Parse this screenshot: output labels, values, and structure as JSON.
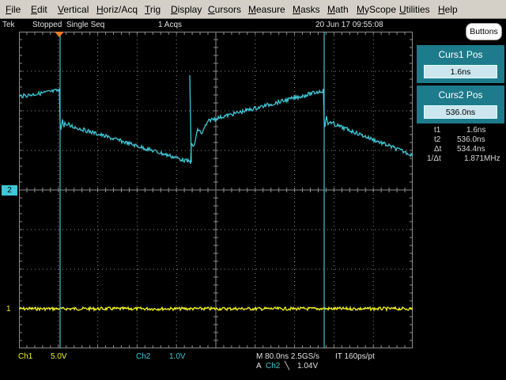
{
  "menu": {
    "items": [
      {
        "u": "F",
        "rest": "ile"
      },
      {
        "u": "E",
        "rest": "dit"
      },
      {
        "u": "V",
        "rest": "ertical"
      },
      {
        "u": "H",
        "rest": "oriz/Acq"
      },
      {
        "u": "T",
        "rest": "rig"
      },
      {
        "u": "D",
        "rest": "isplay"
      },
      {
        "u": "C",
        "rest": "ursors"
      },
      {
        "u": "M",
        "rest": "easure"
      },
      {
        "u": "M",
        "rest": "asks"
      },
      {
        "u": "M",
        "rest": "ath"
      },
      {
        "u": "M",
        "rest": "yScope"
      },
      {
        "u": "U",
        "rest": "tilities"
      },
      {
        "u": "H",
        "rest": "elp"
      }
    ]
  },
  "status": {
    "brand": "Tek",
    "state": "Stopped",
    "mode": "Single Seq",
    "acqs": "1 Acqs",
    "timestamp": "20 Jun 17 09:55:08"
  },
  "buttons_label": "Buttons",
  "cursor1": {
    "title": "Curs1 Pos",
    "value": "1.6ns"
  },
  "cursor2": {
    "title": "Curs2 Pos",
    "value": "536.0ns"
  },
  "readouts": [
    {
      "label": "t1",
      "value": "1.6ns"
    },
    {
      "label": "t2",
      "value": "536.0ns"
    },
    {
      "label": "Δt",
      "value": "534.4ns"
    },
    {
      "label": "1/Δt",
      "value": "1.871MHz"
    }
  ],
  "channels": {
    "ch1": {
      "label": "Ch1",
      "scale": "5.0V",
      "marker": "1",
      "color": "#f2f21e"
    },
    "ch2": {
      "label": "Ch2",
      "scale": "1.0V",
      "marker": "2",
      "color": "#3ec6d6"
    }
  },
  "horizontal": {
    "main": "M 80.0ns 2.5GS/s",
    "interval": "IT 160ps/pt",
    "trigger_prefix": "A",
    "trigger_source": "Ch2",
    "trigger_slope_icon": "falling-edge-icon",
    "trigger_level": "1.04V"
  },
  "colors": {
    "menu_bg": "#d4d0c8",
    "grid": "#8c8c8c",
    "cursor_line": "#3ec6d6",
    "panel_bg": "#1d7b8c",
    "trigger_marker": "#f07a2a"
  }
}
